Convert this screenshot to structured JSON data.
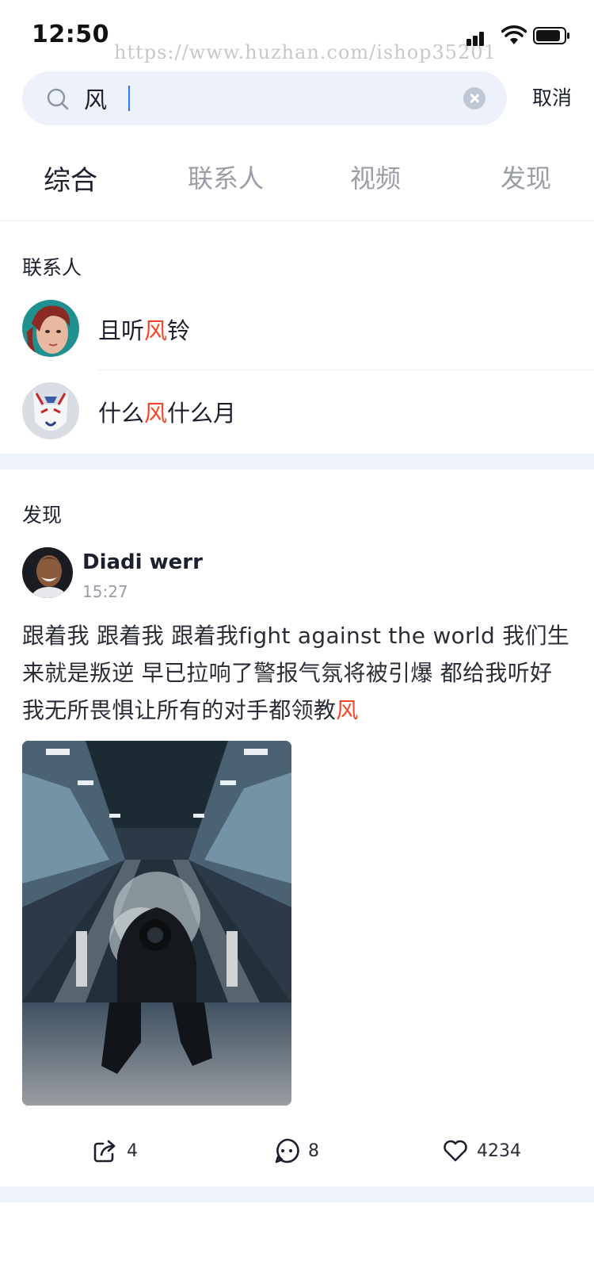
{
  "status_bar": {
    "time": "12:50",
    "watermark": "https://www.huzhan.com/ishop35201",
    "icons": [
      "signal-icon",
      "wifi-icon",
      "battery-icon"
    ]
  },
  "search": {
    "value": "风",
    "placeholder": "",
    "cancel_label": "取消"
  },
  "tabs": [
    {
      "label": "综合",
      "active": true
    },
    {
      "label": "联系人",
      "active": false
    },
    {
      "label": "视频",
      "active": false
    },
    {
      "label": "发现",
      "active": false
    }
  ],
  "contacts_section": {
    "title": "联系人",
    "items": [
      {
        "name_before": "且听",
        "name_highlight": "风",
        "name_after": "铃"
      },
      {
        "name_before": "什么",
        "name_highlight": "风",
        "name_after": "什么月"
      }
    ]
  },
  "discover_section": {
    "title": "发现",
    "post": {
      "author": "Diadi werr",
      "time": "15:27",
      "text_before": "跟着我  跟着我  跟着我fight against the world   我们生来就是叛逆  早已拉响了警报气氛将被引爆  都给我听好我无所畏惧让所有的对手都领教",
      "text_highlight": "风",
      "share_count": "4",
      "comment_count": "8",
      "like_count": "4234"
    }
  },
  "colors": {
    "highlight": "#f2472b",
    "accent": "#2f7cf6",
    "band": "#eef2fb",
    "search_bg": "#edf1f9"
  }
}
